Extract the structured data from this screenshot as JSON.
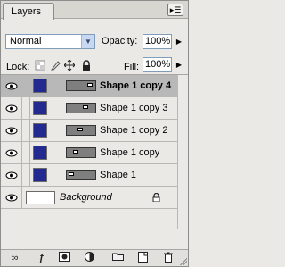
{
  "panel": {
    "tab_label": "Layers",
    "menu_icon": "panel-menu-icon"
  },
  "blend": {
    "mode": "Normal",
    "opacity_label": "Opacity:",
    "opacity_value": "100%"
  },
  "lock": {
    "label": "Lock:",
    "fill_label": "Fill:",
    "fill_value": "100%"
  },
  "layers": [
    {
      "name": "Shape 1 copy 4",
      "selected": true
    },
    {
      "name": "Shape 1 copy 3",
      "selected": false
    },
    {
      "name": "Shape 1 copy 2",
      "selected": false
    },
    {
      "name": "Shape 1 copy",
      "selected": false
    },
    {
      "name": "Shape 1",
      "selected": false
    }
  ],
  "background_layer": {
    "name": "Background"
  },
  "colors": {
    "shape_fill": "#232a8f",
    "selected_row": "#b8b8b8"
  }
}
